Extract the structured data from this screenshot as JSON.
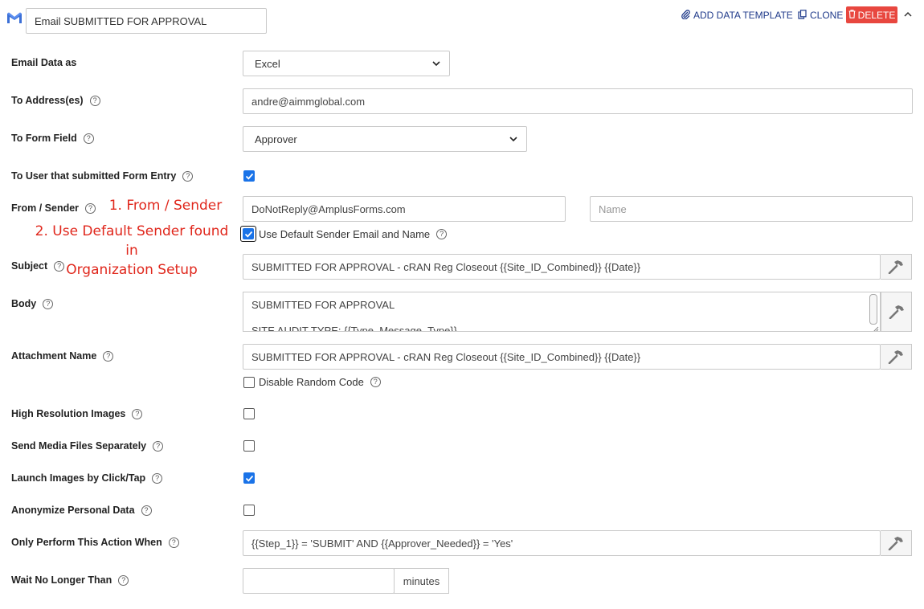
{
  "header": {
    "action_icon": "gmail-icon",
    "action_name": "Email SUBMITTED FOR APPROVAL",
    "add_data_template": "ADD DATA TEMPLATE",
    "clone": "CLONE",
    "delete": "DELETE"
  },
  "labels": {
    "email_data_as": "Email Data as",
    "to_addresses": "To Address(es)",
    "to_form_field": "To Form Field",
    "to_user_submitted": "To User that submitted Form Entry",
    "from_sender": "From / Sender",
    "subject": "Subject",
    "body": "Body",
    "attachment_name": "Attachment Name",
    "high_res": "High Resolution Images",
    "send_media": "Send Media Files Separately",
    "launch_images": "Launch Images by Click/Tap",
    "anonymize": "Anonymize Personal Data",
    "only_perform": "Only Perform This Action When",
    "wait_no_longer": "Wait No Longer Than"
  },
  "fields": {
    "email_data_as": "Excel",
    "to_addresses": "andre@aimmglobal.com",
    "to_form_field": "Approver",
    "to_user_submitted_checked": true,
    "sender_email": "DoNotReply@AmplusForms.com",
    "sender_name_placeholder": "Name",
    "use_default_sender_label": "Use Default Sender Email and Name",
    "use_default_sender_checked": true,
    "subject": "SUBMITTED FOR APPROVAL - cRAN Reg Closeout {{Site_ID_Combined}} {{Date}}",
    "body_line1": "SUBMITTED FOR APPROVAL",
    "body_line2": "SITE AUDIT TYPE: {{Type_Message_Type}}",
    "attachment_name": "SUBMITTED FOR APPROVAL - cRAN Reg Closeout {{Site_ID_Combined}} {{Date}}",
    "disable_random_code_label": "Disable Random Code",
    "disable_random_code_checked": false,
    "high_res_checked": false,
    "send_media_checked": false,
    "launch_images_checked": true,
    "anonymize_checked": false,
    "only_perform": "{{Step_1}} = 'SUBMIT' AND {{Approver_Needed}} = 'Yes'",
    "wait_value": "",
    "wait_unit": "minutes"
  },
  "annotations": {
    "note1": "1. From / Sender",
    "note2_line1": "2. Use Default Sender found in",
    "note2_line2": "Organization Setup"
  },
  "colors": {
    "accent": "#1a73e8",
    "delete": "#e8473f",
    "annotation": "#e0271c",
    "link": "#1f3a8a"
  }
}
